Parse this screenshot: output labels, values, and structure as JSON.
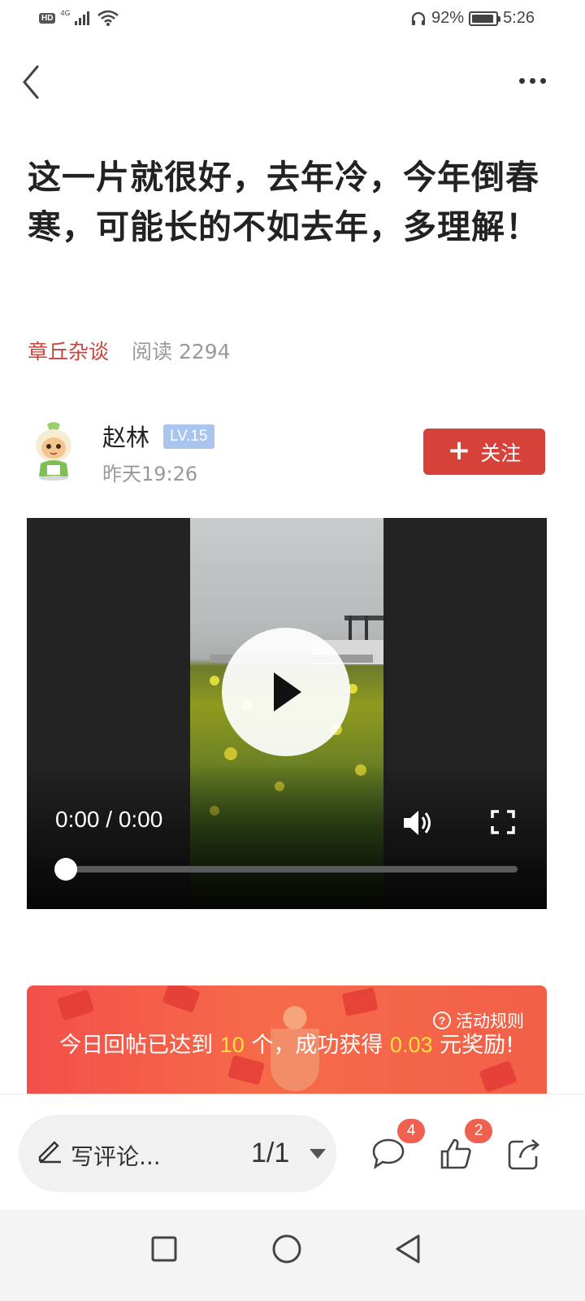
{
  "status_bar": {
    "hd": "HD",
    "network": "4G",
    "battery": "92%",
    "time": "5:26"
  },
  "nav": {
    "back_icon": "chevron-left-icon",
    "more_icon": "more-horizontal-icon"
  },
  "post": {
    "title": "这一片就很好，去年冷，今年倒春寒，可能长的不如去年，多理解！",
    "channel": "章丘杂谈",
    "reads": "阅读 2294"
  },
  "author": {
    "name": "赵林",
    "level": "LV.15",
    "time": "昨天19:26",
    "follow_label": "关注"
  },
  "video": {
    "time": "0:00 / 0:00",
    "progress": 0
  },
  "banner": {
    "rules": "活动规则",
    "text_1": "今日回帖已达到 ",
    "count": "10",
    "text_2": " 个，成功获得 ",
    "amount": "0.03",
    "text_3": " 元奖励!"
  },
  "bottom_bar": {
    "comment_placeholder": "写评论...",
    "page": "1/1",
    "comments_count": "4",
    "likes_count": "2"
  },
  "colors": {
    "accent": "#d6413a",
    "channel": "#c8443a",
    "level_badge": "#a9c4ef",
    "highlight": "#ffe13b"
  }
}
